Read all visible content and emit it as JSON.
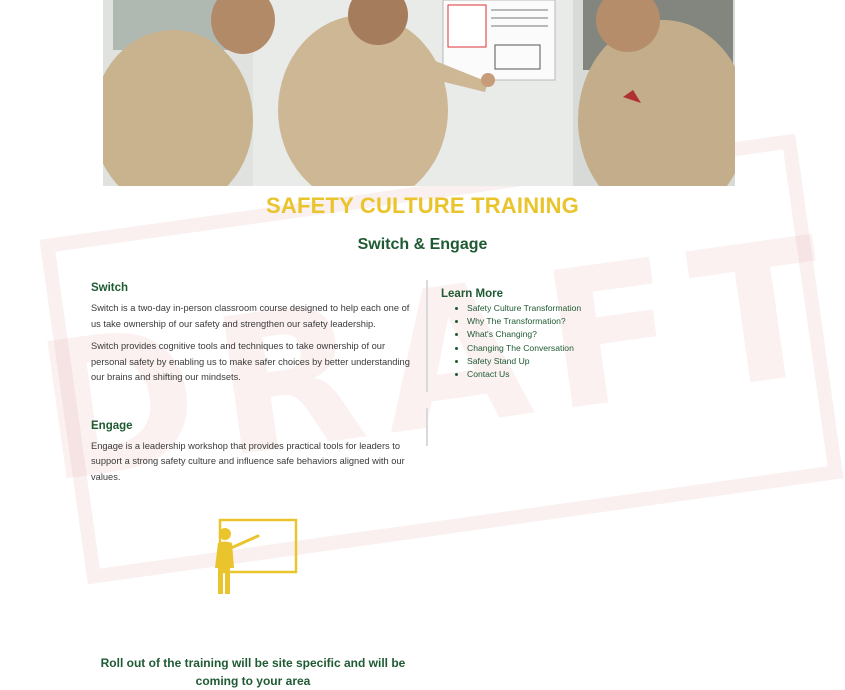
{
  "watermark": "DRAFT",
  "hero_image": {
    "alt": "Workers reviewing a safety checklist on a truck"
  },
  "page": {
    "title": "SAFETY CULTURE TRAINING",
    "subtitle": "Switch & Engage"
  },
  "switch": {
    "heading": "Switch",
    "p1": "Switch is a two-day in-person classroom course designed to help each one of us take ownership of our safety and strengthen our safety leadership.",
    "p2": "Switch provides cognitive tools and techniques to take ownership of our personal safety by enabling us to make safer choices by better understanding our brains and shifting our mindsets."
  },
  "engage": {
    "heading": "Engage",
    "p1": "Engage is a leadership workshop that provides practical tools for leaders to support a strong safety culture and influence safe behaviors aligned with our values."
  },
  "learn_more": {
    "heading": "Learn More",
    "links": [
      "Safety Culture Transformation",
      "Why The Transformation?",
      "What's Changing?",
      "Changing The Conversation",
      "Safety Stand Up",
      "Contact Us"
    ]
  },
  "icons": {
    "trainer": "presenter-whiteboard-icon"
  },
  "colors": {
    "accent_yellow": "#e9c42d",
    "brand_green": "#1f5a33"
  },
  "rollout": "Roll out of the training will be site specific and will be coming to your area"
}
